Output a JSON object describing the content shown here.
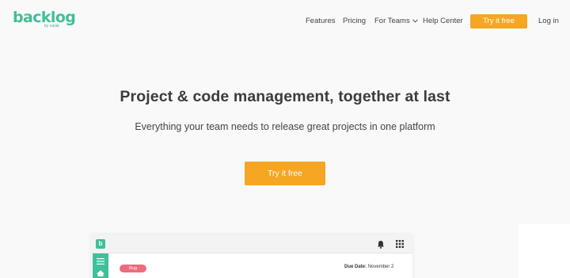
{
  "brand": {
    "name": "backlog",
    "byline": "by nulab"
  },
  "nav": {
    "items": [
      "Features",
      "Pricing",
      "For Teams",
      "Help Center"
    ],
    "cta": "Try it free",
    "login": "Log in"
  },
  "hero": {
    "title": "Project & code management, together at last",
    "subtitle": "Everything your team needs to release great projects in one platform",
    "cta": "Try it free"
  },
  "preview": {
    "logo_letter": "b",
    "badge": "Bug",
    "due_label": "Due Date:",
    "due_value": "November 2"
  },
  "colors": {
    "brand_green": "#3fbf9a",
    "cta_orange": "#f5a623",
    "bug_pink": "#f06a7d",
    "background": "#f9f9f9"
  },
  "icons": [
    "chevron-down-icon",
    "bell-icon",
    "apps-grid-icon",
    "menu-icon",
    "home-icon"
  ]
}
